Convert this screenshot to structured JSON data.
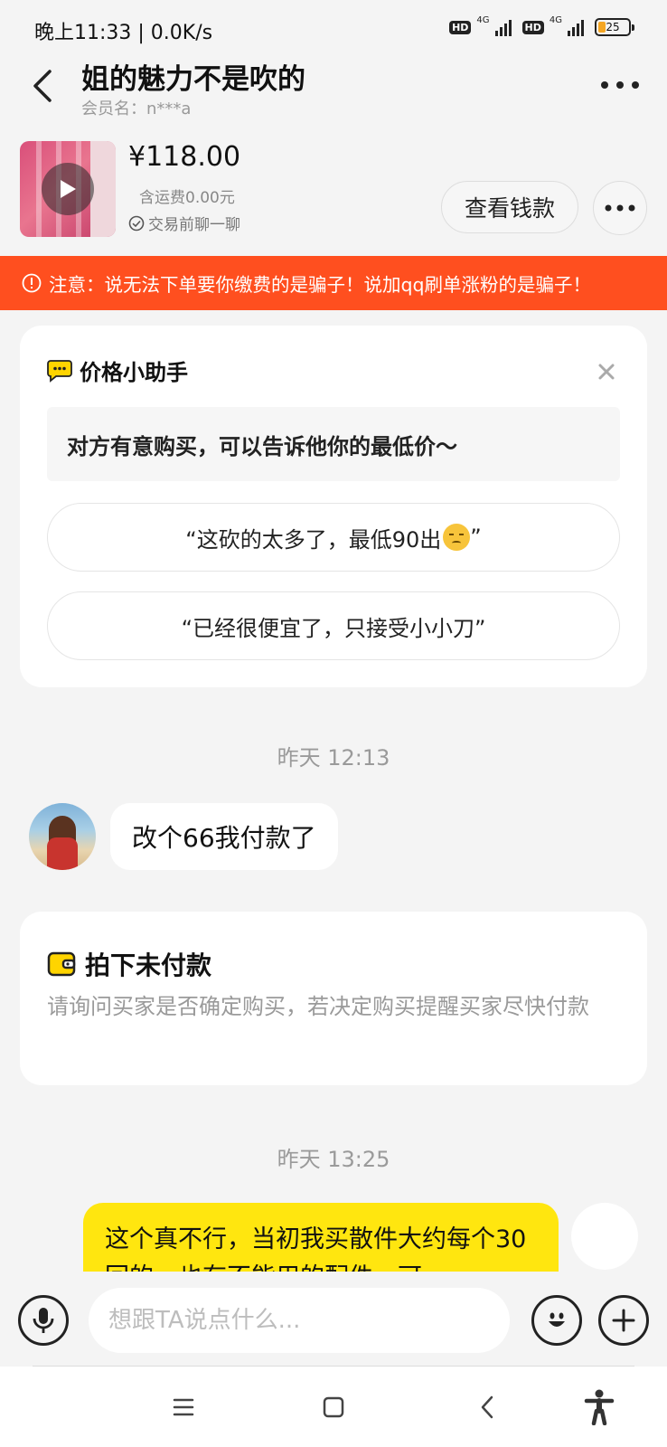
{
  "status_bar": {
    "time": "晚上11:33 | 0.0K/s",
    "hd1": "HD",
    "net1": "4G",
    "hd2": "HD",
    "net2": "4G",
    "battery": "25"
  },
  "header": {
    "title": "姐的魅力不是吹的",
    "subtitle": "会员名：n***a"
  },
  "product": {
    "price": "¥118.00",
    "shipping": "含运费0.00元",
    "chat_hint": "交易前聊一聊",
    "view_button": "查看钱款"
  },
  "warning": {
    "text": "注意：说无法下单要你缴费的是骗子！说加qq刷单涨粉的是骗子！",
    "color": "#ff4f1f"
  },
  "price_helper": {
    "title": "价格小助手",
    "tip": "对方有意购买，可以告诉他你的最低价～",
    "quick_replies": [
      {
        "text": "“这砍的太多了，最低90出",
        "suffix": "”"
      },
      {
        "text": "“已经很便宜了，只接受小小刀”",
        "suffix": ""
      }
    ]
  },
  "conversation": {
    "time1": "昨天 12:13",
    "buyer_message": "改个66我付款了",
    "unpaid_card": {
      "title": "拍下未付款",
      "description": "请询问买家是否确定购买，若决定购买提醒买家尽快付款"
    },
    "time2": "昨天 13:25",
    "seller_message": "这个真不行，当初我买散件大约每个30回的，也有不能用的配件，可"
  },
  "input_bar": {
    "placeholder": "想跟TA说点什么..."
  },
  "colors": {
    "accent_yellow": "#ffe60f",
    "warning_red": "#ff4f1f",
    "background": "#f4f4f4"
  }
}
